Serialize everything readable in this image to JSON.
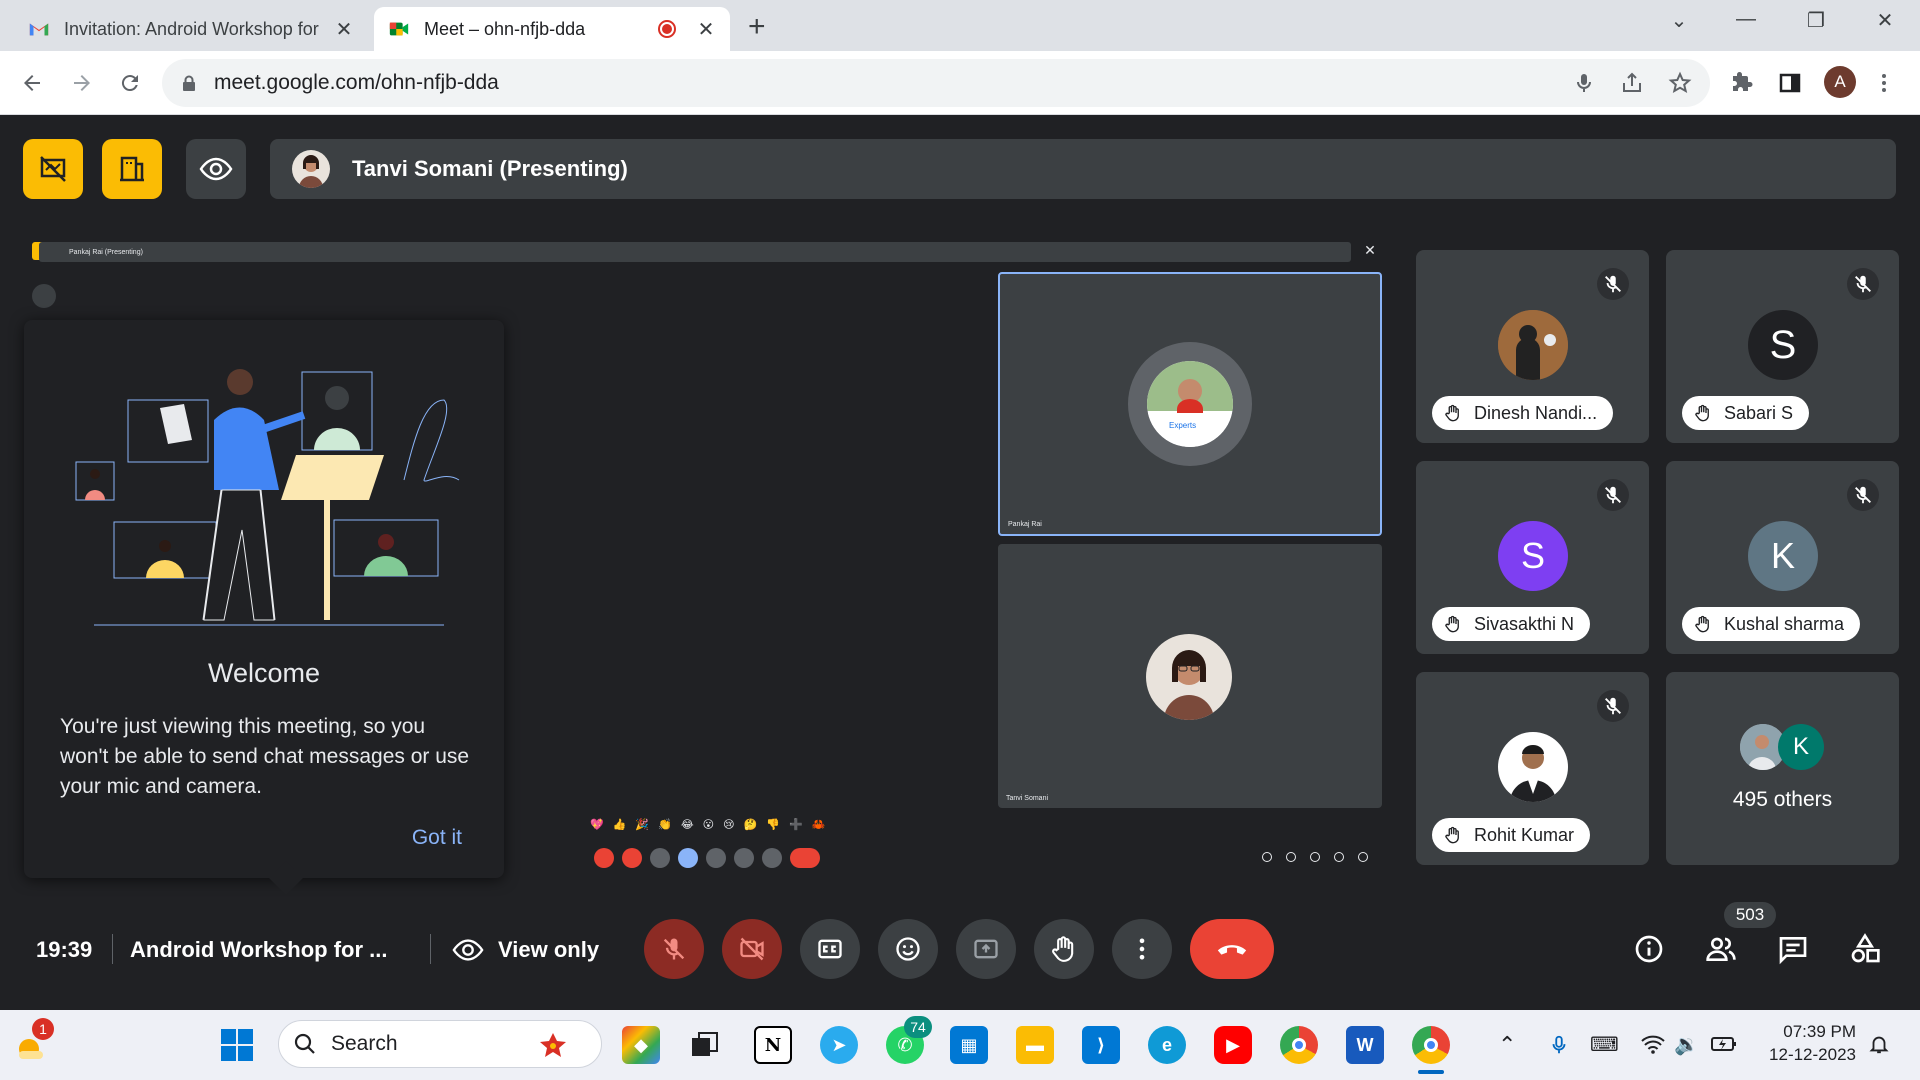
{
  "browser": {
    "tabs": [
      {
        "title": "Invitation: Android Workshop for",
        "active": false
      },
      {
        "title": "Meet – ohn-nfjb-dda",
        "active": true
      }
    ],
    "url": "meet.google.com/ohn-nfjb-dda",
    "profile_initial": "A"
  },
  "header": {
    "presenting_label": "Tanvi Somani (Presenting)"
  },
  "shared_screen": {
    "inner_presenting_label": "Pankaj Rai (Presenting)",
    "welcome_title": "Welcome",
    "welcome_text": "You're just viewing this meeting, so you won't be able to send chat messages or use your mic and camera.",
    "got_it_label": "Got it",
    "tiles": [
      {
        "name": "Pankaj Rai"
      },
      {
        "name": "Tanvi Somani"
      }
    ],
    "badge_text": "Experts"
  },
  "participants": [
    {
      "name": "Dinesh Nandi...",
      "initial": "",
      "color": "#7f5a3c",
      "muted": true,
      "hand_raised": true
    },
    {
      "name": "Sabari S",
      "initial": "S",
      "color": "#202124",
      "muted": true,
      "hand_raised": true
    },
    {
      "name": "Sivasakthi N",
      "initial": "S",
      "color": "#7e3ff2",
      "muted": true,
      "hand_raised": true
    },
    {
      "name": "Kushal sharma",
      "initial": "K",
      "color": "#5f7684",
      "muted": true,
      "hand_raised": true
    },
    {
      "name": "Rohit Kumar",
      "initial": "",
      "color": "#ffffff",
      "muted": true,
      "hand_raised": true
    }
  ],
  "others": {
    "label": "495 others",
    "initial": "K",
    "color": "#00796b"
  },
  "bottom_bar": {
    "time": "19:39",
    "meeting_name": "Android Workshop for ...",
    "view_only_label": "View only",
    "participant_count": "503"
  },
  "taskbar": {
    "search_placeholder": "Search",
    "whatsapp_badge": "74",
    "notification_badge": "1",
    "clock_time": "07:39 PM",
    "clock_date": "12-12-2023"
  }
}
